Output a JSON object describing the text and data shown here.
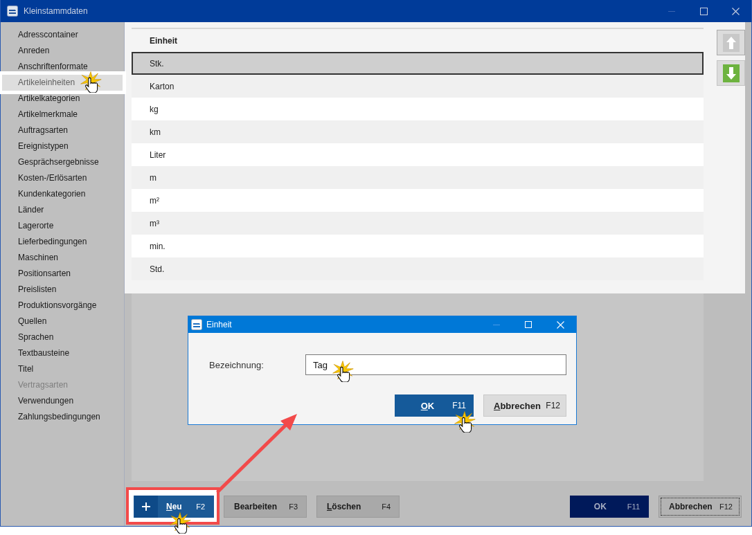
{
  "window": {
    "title": "Kleinstammdaten"
  },
  "sidebar": {
    "items": [
      {
        "label": "Adresscontainer",
        "selected": false,
        "disabled": false,
        "clicked": false
      },
      {
        "label": "Anreden",
        "selected": false,
        "disabled": false,
        "clicked": false
      },
      {
        "label": "Anschriftenformate",
        "selected": false,
        "disabled": false,
        "clicked": false
      },
      {
        "label": "Artikeleinheiten",
        "selected": true,
        "disabled": false,
        "clicked": true
      },
      {
        "label": "Artikelkategorien",
        "selected": false,
        "disabled": false,
        "clicked": false
      },
      {
        "label": "Artikelmerkmale",
        "selected": false,
        "disabled": false,
        "clicked": false
      },
      {
        "label": "Auftragsarten",
        "selected": false,
        "disabled": false,
        "clicked": false
      },
      {
        "label": "Ereignistypen",
        "selected": false,
        "disabled": false,
        "clicked": false
      },
      {
        "label": "Gesprächsergebnisse",
        "selected": false,
        "disabled": false,
        "clicked": false
      },
      {
        "label": "Kosten-/Erlösarten",
        "selected": false,
        "disabled": false,
        "clicked": false
      },
      {
        "label": "Kundenkategorien",
        "selected": false,
        "disabled": false,
        "clicked": false
      },
      {
        "label": "Länder",
        "selected": false,
        "disabled": false,
        "clicked": false
      },
      {
        "label": "Lagerorte",
        "selected": false,
        "disabled": false,
        "clicked": false
      },
      {
        "label": "Lieferbedingungen",
        "selected": false,
        "disabled": false,
        "clicked": false
      },
      {
        "label": "Maschinen",
        "selected": false,
        "disabled": false,
        "clicked": false
      },
      {
        "label": "Positionsarten",
        "selected": false,
        "disabled": false,
        "clicked": false
      },
      {
        "label": "Preislisten",
        "selected": false,
        "disabled": false,
        "clicked": false
      },
      {
        "label": "Produktionsvorgänge",
        "selected": false,
        "disabled": false,
        "clicked": false
      },
      {
        "label": "Quellen",
        "selected": false,
        "disabled": false,
        "clicked": false
      },
      {
        "label": "Sprachen",
        "selected": false,
        "disabled": false,
        "clicked": false
      },
      {
        "label": "Textbausteine",
        "selected": false,
        "disabled": false,
        "clicked": false
      },
      {
        "label": "Titel",
        "selected": false,
        "disabled": false,
        "clicked": false
      },
      {
        "label": "Vertragsarten",
        "selected": false,
        "disabled": true,
        "clicked": false
      },
      {
        "label": "Verwendungen",
        "selected": false,
        "disabled": false,
        "clicked": false
      },
      {
        "label": "Zahlungsbedingungen",
        "selected": false,
        "disabled": false,
        "clicked": false
      }
    ]
  },
  "table": {
    "columns": [
      "Einheit"
    ],
    "rows": [
      {
        "cells": [
          "Stk."
        ],
        "selected": true
      },
      {
        "cells": [
          "Karton"
        ],
        "selected": false
      },
      {
        "cells": [
          "kg"
        ],
        "selected": false
      },
      {
        "cells": [
          "km"
        ],
        "selected": false
      },
      {
        "cells": [
          "Liter"
        ],
        "selected": false
      },
      {
        "cells": [
          "m"
        ],
        "selected": false
      },
      {
        "cells": [
          "m²"
        ],
        "selected": false
      },
      {
        "cells": [
          "m³"
        ],
        "selected": false
      },
      {
        "cells": [
          "min."
        ],
        "selected": false
      },
      {
        "cells": [
          "Std."
        ],
        "selected": false
      }
    ]
  },
  "move_buttons": [
    {
      "kind": "up",
      "disabled": true
    },
    {
      "kind": "down",
      "disabled": false
    }
  ],
  "toolbar": {
    "left_buttons": [
      {
        "kind": "add",
        "label": "Neu",
        "shortcut": "F2",
        "underline_first": true,
        "clicked": true,
        "highlighted": true
      },
      {
        "kind": "plain",
        "label": "Bearbeiten",
        "shortcut": "F3",
        "underline_first": false,
        "clicked": false,
        "highlighted": false
      },
      {
        "kind": "plain",
        "label": "Löschen",
        "shortcut": "F4",
        "underline_first": true,
        "clicked": false,
        "highlighted": false
      }
    ],
    "right_buttons": [
      {
        "kind": "primary",
        "label": "OK",
        "shortcut": "F11",
        "focused": false
      },
      {
        "kind": "plain",
        "label": "Abbrechen",
        "shortcut": "F12",
        "focused": true
      }
    ]
  },
  "dialog": {
    "title": "Einheit",
    "field": {
      "label": "Bezeichnung:",
      "value": "Tag",
      "clicked": true
    },
    "buttons": [
      {
        "kind": "primary",
        "label": "OK",
        "shortcut": "F11",
        "underline_first": true,
        "clicked": true
      },
      {
        "kind": "plain",
        "label": "Abbrechen",
        "shortcut": "F12",
        "underline_first": true,
        "clicked": false
      }
    ]
  },
  "annotation": {
    "callout_arrow": true
  }
}
